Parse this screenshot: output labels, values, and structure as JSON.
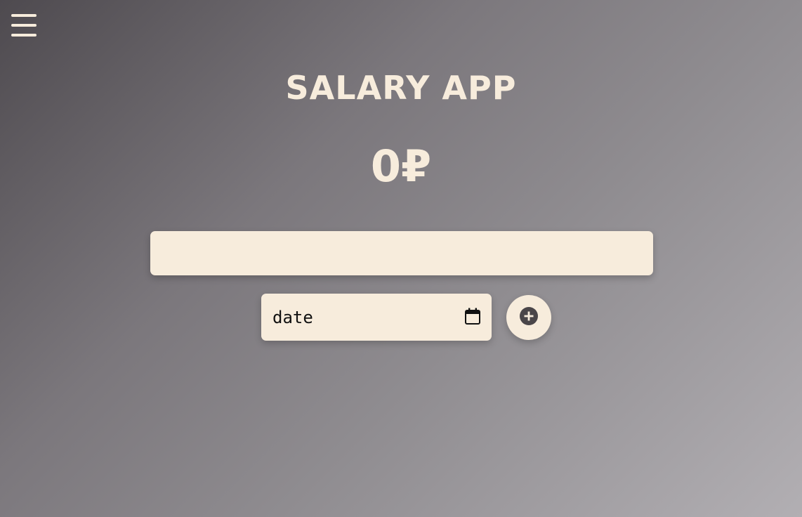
{
  "header": {
    "menu_icon": "hamburger-menu-icon",
    "title": "SALARY APP"
  },
  "balance": {
    "display": "0₽"
  },
  "form": {
    "amount_value": "",
    "date_label": "date",
    "calendar_icon": "calendar-icon",
    "add_icon": "plus-circle-icon"
  },
  "colors": {
    "panel": "#f7ecdc",
    "text_light": "#f7ecdc",
    "icon_dark": "#4a4649"
  }
}
